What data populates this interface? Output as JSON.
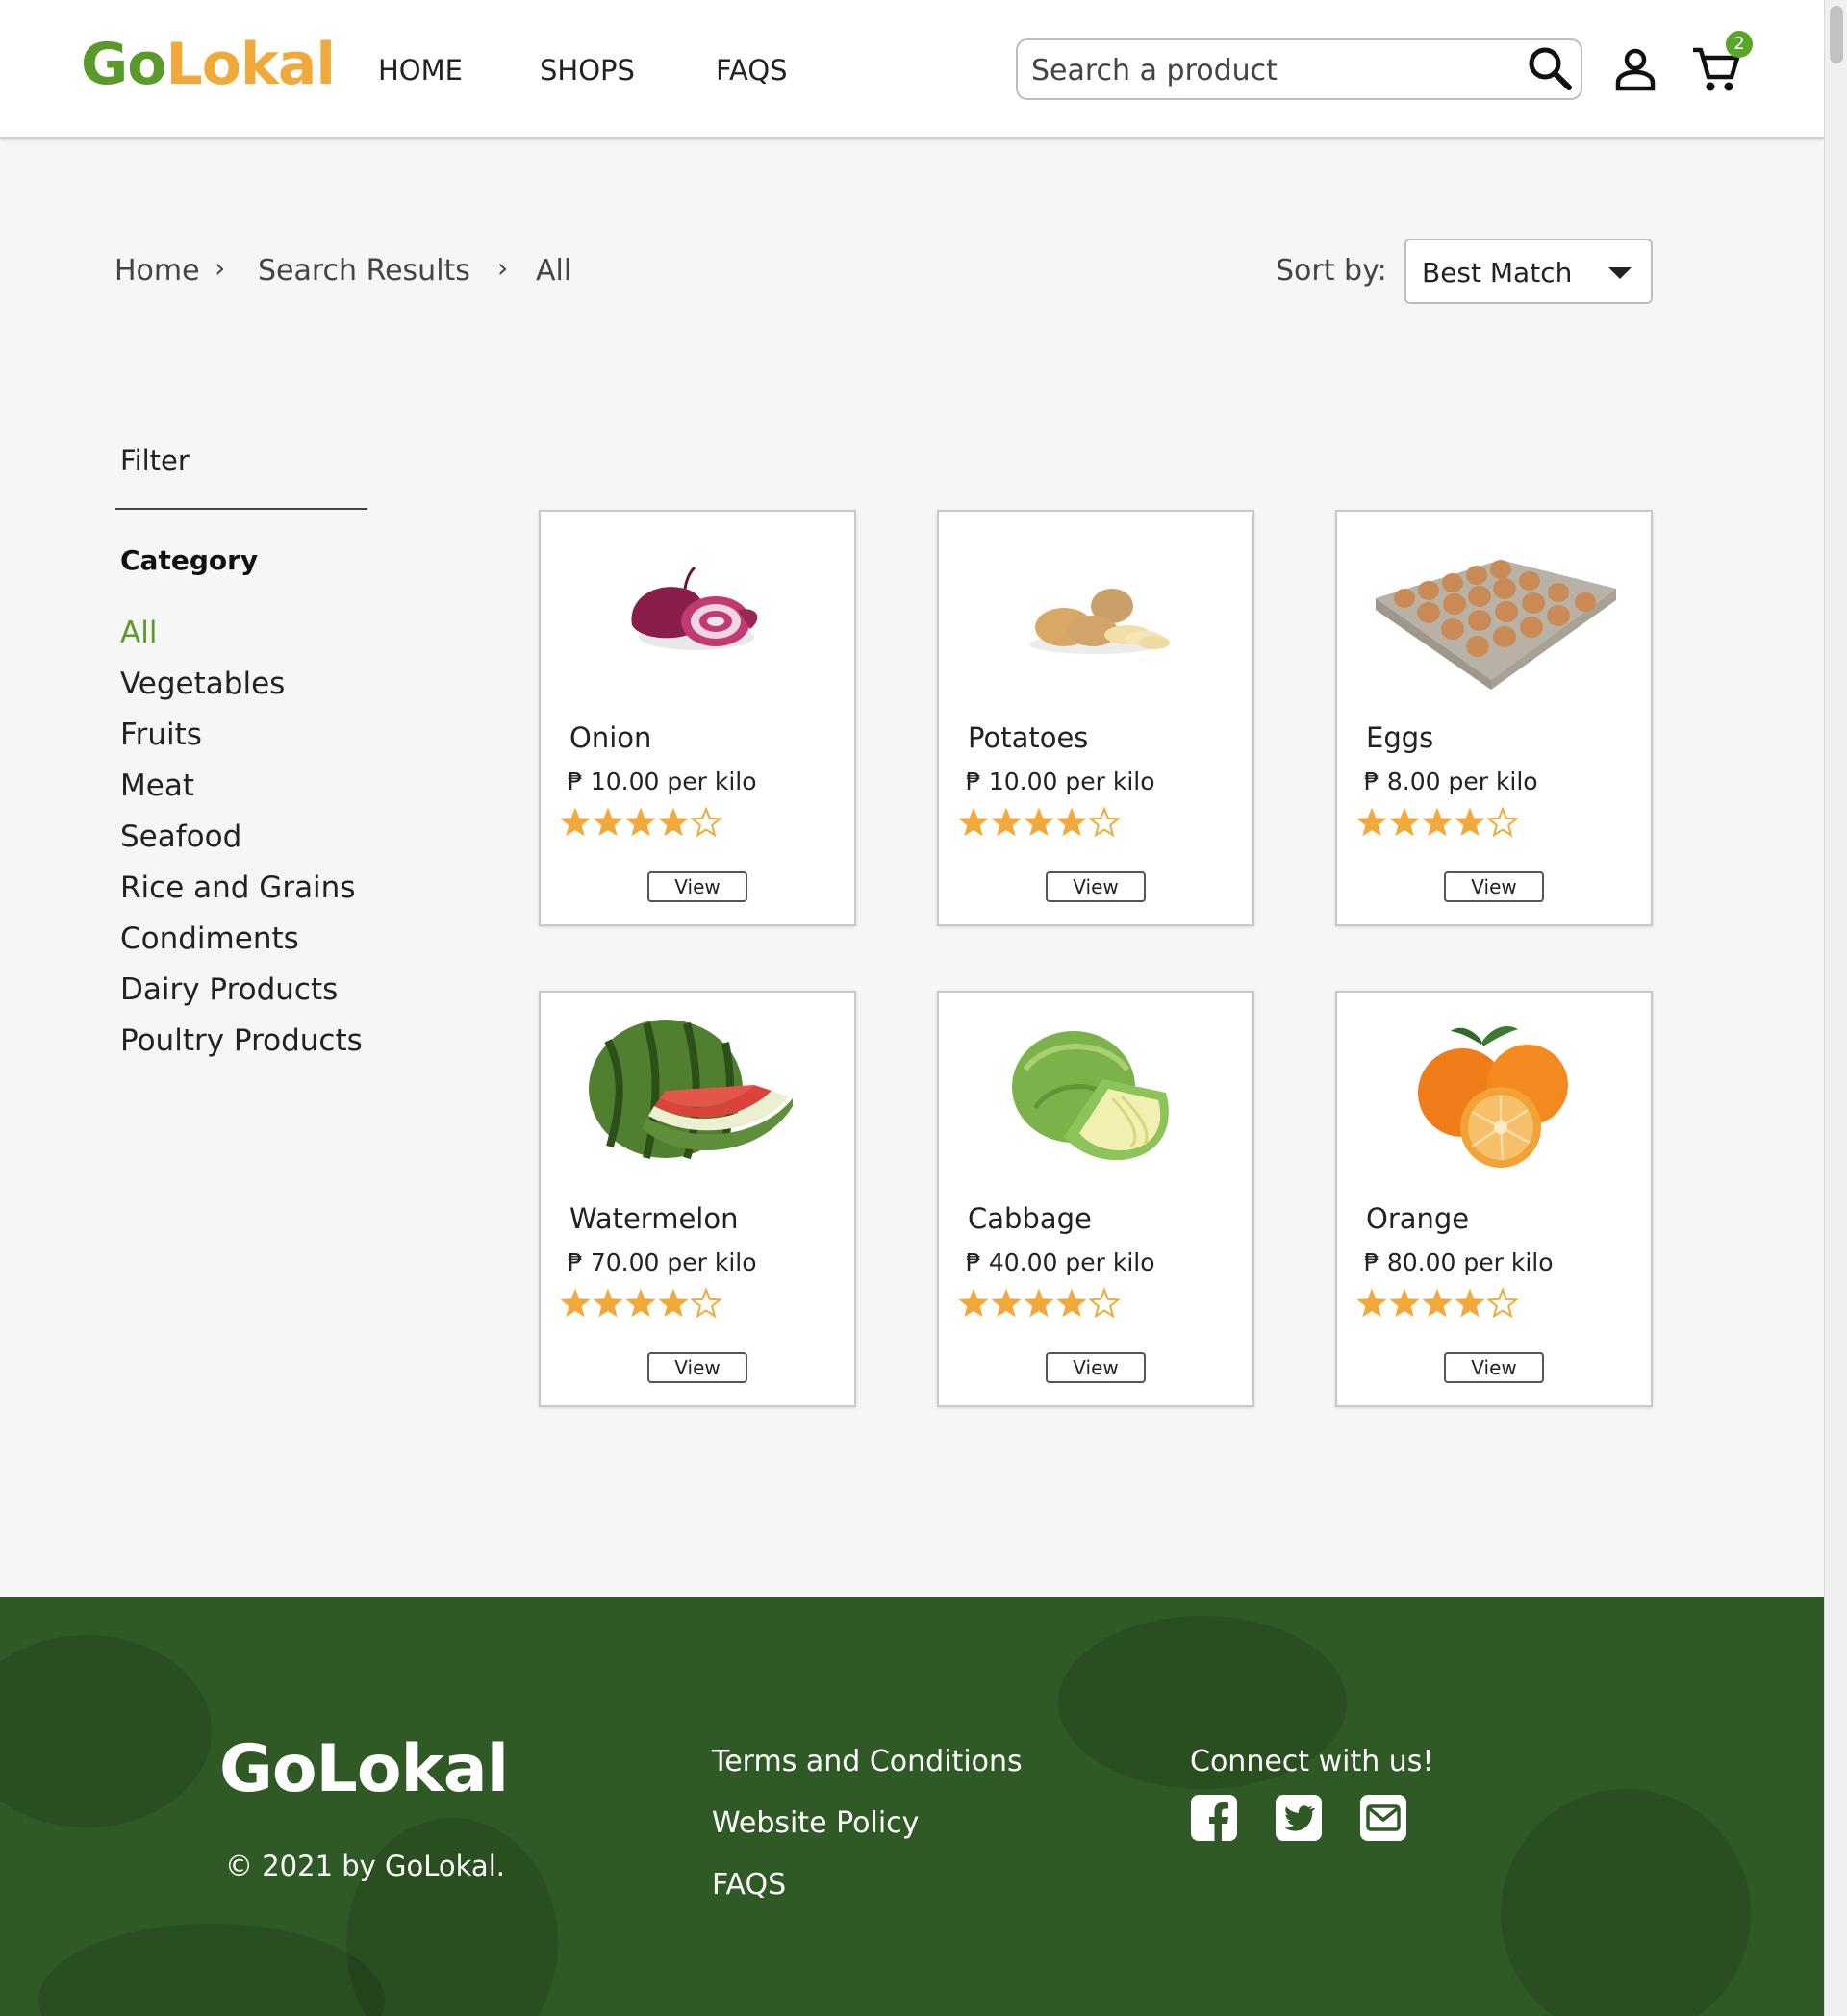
{
  "header": {
    "logo_part1": "Go",
    "logo_part2": "Lokal",
    "nav": [
      "HOME",
      "SHOPS",
      "FAQS"
    ],
    "search_placeholder": "Search a product",
    "cart_count": "2"
  },
  "breadcrumb": [
    "Home",
    "Search Results",
    "All"
  ],
  "sort": {
    "label": "Sort by:",
    "value": "Best Match"
  },
  "filter": {
    "title": "Filter",
    "category_title": "Category",
    "categories": [
      "All",
      "Vegetables",
      "Fruits",
      "Meat",
      "Seafood",
      "Rice and Grains",
      "Condiments",
      "Dairy Products",
      "Poultry Products"
    ],
    "active_category": "All"
  },
  "products": [
    {
      "name": "Onion",
      "price": "₱ 10.00 per kilo",
      "rating": 4,
      "max_rating": 5,
      "button": "View",
      "image": "onion-image"
    },
    {
      "name": "Potatoes",
      "price": "₱ 10.00 per kilo",
      "rating": 4,
      "max_rating": 5,
      "button": "View",
      "image": "potatoes-image"
    },
    {
      "name": "Eggs",
      "price": "₱ 8.00 per kilo",
      "rating": 4,
      "max_rating": 5,
      "button": "View",
      "image": "eggs-tray-image"
    },
    {
      "name": "Watermelon",
      "price": "₱ 70.00 per kilo",
      "rating": 4,
      "max_rating": 5,
      "button": "View",
      "image": "watermelon-image"
    },
    {
      "name": "Cabbage",
      "price": "₱ 40.00 per kilo",
      "rating": 4,
      "max_rating": 5,
      "button": "View",
      "image": "cabbage-image"
    },
    {
      "name": "Orange",
      "price": "₱ 80.00 per kilo",
      "rating": 4,
      "max_rating": 5,
      "button": "View",
      "image": "orange-image"
    }
  ],
  "footer": {
    "logo": "GoLokal",
    "copyright": "© 2021 by GoLokal.",
    "links": [
      "Terms and Conditions",
      "Website Policy",
      "FAQS"
    ],
    "connect": "Connect with us!",
    "social": [
      "facebook-icon",
      "twitter-icon",
      "email-icon"
    ]
  },
  "colors": {
    "brand_green": "#5a9a28",
    "brand_orange": "#f2a93b",
    "star": "#f2a93b",
    "footer_bg": "#2f5a25",
    "badge": "#5aa628"
  }
}
